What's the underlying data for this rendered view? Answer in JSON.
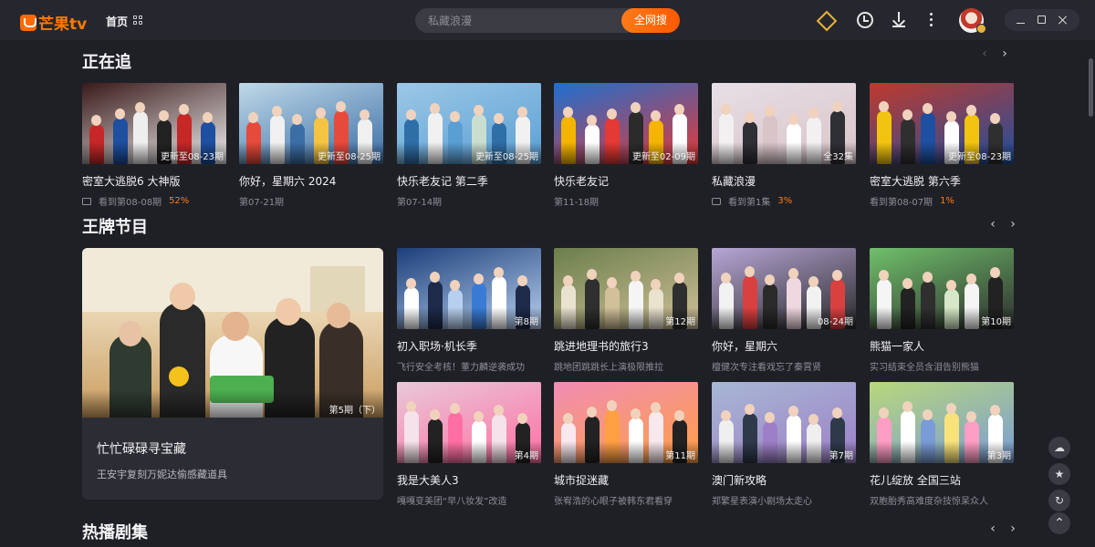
{
  "app": {
    "logo_text": "芒果tv"
  },
  "nav": {
    "home_label": "首页"
  },
  "search": {
    "placeholder": "私藏浪漫",
    "button_label": "全网搜"
  },
  "sections": {
    "watching": {
      "title": "正在追"
    },
    "ace": {
      "title": "王牌节目"
    },
    "drama": {
      "title": "热播剧集"
    }
  },
  "watching": [
    {
      "title": "密室大逃脱6 大神版",
      "badge": "更新至08-23期",
      "sub": "看到第08-08期",
      "pct": "52%",
      "icon": "screen-icon"
    },
    {
      "title": "你好，星期六 2024",
      "badge": "更新至08-25期",
      "sub": "第07-21期",
      "pct": "",
      "icon": ""
    },
    {
      "title": "快乐老友记 第二季",
      "badge": "更新至08-25期",
      "sub": "第07-14期",
      "pct": "",
      "icon": ""
    },
    {
      "title": "快乐老友记",
      "badge": "更新至02-09期",
      "sub": "第11-18期",
      "pct": "",
      "icon": ""
    },
    {
      "title": "私藏浪漫",
      "badge": "全32集",
      "sub": "看到第1集",
      "pct": "3%",
      "icon": "chat-icon"
    },
    {
      "title": "密室大逃脱 第六季",
      "badge": "更新至08-23期",
      "sub": "看到第08-07期",
      "pct": "1%",
      "icon": ""
    }
  ],
  "feature": {
    "title": "忙忙碌碌寻宝藏",
    "sub": "王安宇复刻万妮达偷感藏道具",
    "badge": "第5期（下）"
  },
  "ace": [
    {
      "title": "初入职场·机长季",
      "badge": "第8期",
      "sub": "飞行安全考核！董力麟逆袭成功"
    },
    {
      "title": "跳进地理书的旅行3",
      "badge": "第12期",
      "sub": "跳地团跳跳长上演极限推拉"
    },
    {
      "title": "你好，星期六",
      "badge": "08-24期",
      "sub": "檀健次专注看戏忘了秦霄贤"
    },
    {
      "title": "熊猫一家人",
      "badge": "第10期",
      "sub": "实习结束全员含泪告别熊猫"
    },
    {
      "title": "我是大美人3",
      "badge": "第4期",
      "sub": "嘎嘎变美团“早八妆发”改造"
    },
    {
      "title": "城市捉迷藏",
      "badge": "第11期",
      "sub": "张宥浩的心眼子被韩东君看穿"
    },
    {
      "title": "澳门新攻略",
      "badge": "第7期",
      "sub": "郑繁星表演小剧场太走心"
    },
    {
      "title": "花儿绽放 全国三站",
      "badge": "第3期",
      "sub": "双胞胎秀高难度杂技惊呆众人"
    }
  ],
  "icons": [
    "mango-logo-icon",
    "grid-icon",
    "vip-diamond-icon",
    "history-clock-icon",
    "download-icon",
    "more-icon",
    "avatar",
    "minimize-icon",
    "maximize-icon",
    "close-icon",
    "chevron-left-icon",
    "chevron-right-icon",
    "cloud-icon",
    "star-icon",
    "refresh-icon",
    "back-to-top-icon"
  ],
  "colors": {
    "brand": "#ff6a00",
    "accent_pct": "#ff7a18",
    "background": "#1f2026",
    "vip": "#e8b23a"
  }
}
